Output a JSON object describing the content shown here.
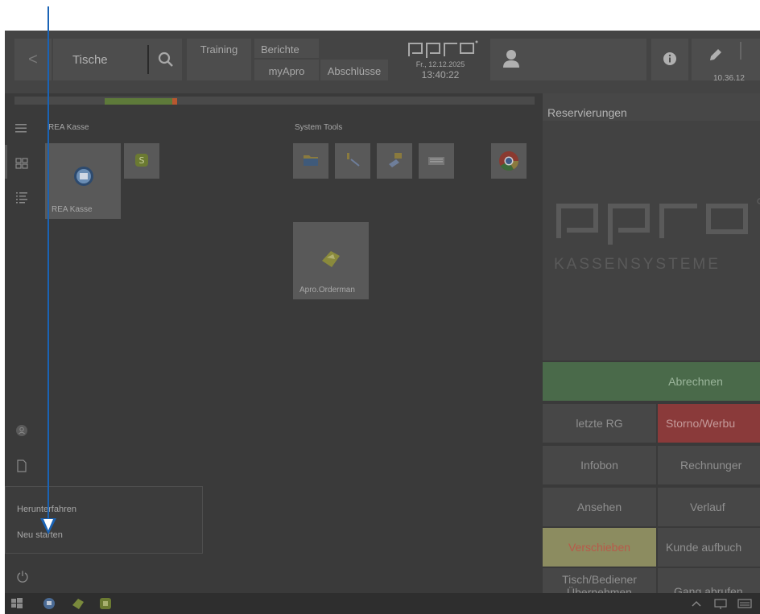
{
  "topbar": {
    "back_label": "<",
    "tische_label": "Tische",
    "training_label": "Training",
    "berichte_label": "Berichte",
    "myapro_label": "myApro",
    "abschluesse_label": "Abschlüsse",
    "logo_text": "apro",
    "date": "Fr., 12.12.2025",
    "time": "13:40:22",
    "version": "10.36.12"
  },
  "sidebar": {
    "groups": [
      {
        "label": "REA Kasse"
      },
      {
        "label": "System Tools"
      }
    ],
    "tiles": {
      "rea_kasse": "REA Kasse",
      "apro_orderman": "Apro.Orderman"
    }
  },
  "start_menu": {
    "items": [
      {
        "label": "Herunterfahren"
      },
      {
        "label": "Neu starten"
      }
    ]
  },
  "reservations": {
    "title": "Reservierungen",
    "brand": "apro",
    "brand_sub": "KASSENSYSTEME"
  },
  "actions": {
    "abrechnen": "Abrechnen",
    "letzte_rg": "letzte RG",
    "storno": "Storno/Werbu",
    "infobon": "Infobon",
    "rechnungen": "Rechnunger",
    "ansehen": "Ansehen",
    "verlauf": "Verlauf",
    "verschieben": "Verschieben",
    "kunde": "Kunde aufbuch",
    "tisch_line1": "Tisch/Bediener",
    "tisch_line2": "Übernehmen",
    "gang": "Gang abrufen"
  },
  "colors": {
    "overlay_bg": "#3a3a3a",
    "accent_green": "#4a6a4a",
    "accent_red": "#8a3a3a",
    "arrow": "#1a63b5"
  }
}
